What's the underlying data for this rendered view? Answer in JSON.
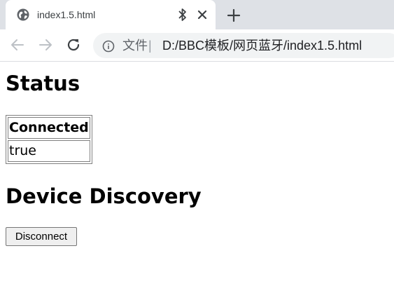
{
  "browser": {
    "tab": {
      "title": "index1.5.html",
      "favicon_icon": "globe-icon",
      "bluetooth_icon": "bluetooth-icon",
      "close_icon": "close-icon"
    },
    "new_tab_icon": "plus-icon",
    "toolbar": {
      "back_icon": "arrow-left-icon",
      "forward_icon": "arrow-right-icon",
      "reload_icon": "reload-icon",
      "info_icon": "info-icon",
      "security_label": "文件",
      "separator": "|",
      "url": "D:/BBC模板/网页蓝牙/index1.5.html"
    }
  },
  "page": {
    "status_heading": "Status",
    "status_table": {
      "header": "Connected",
      "value": "true"
    },
    "discovery_heading": "Device Discovery",
    "disconnect_label": "Disconnect"
  }
}
